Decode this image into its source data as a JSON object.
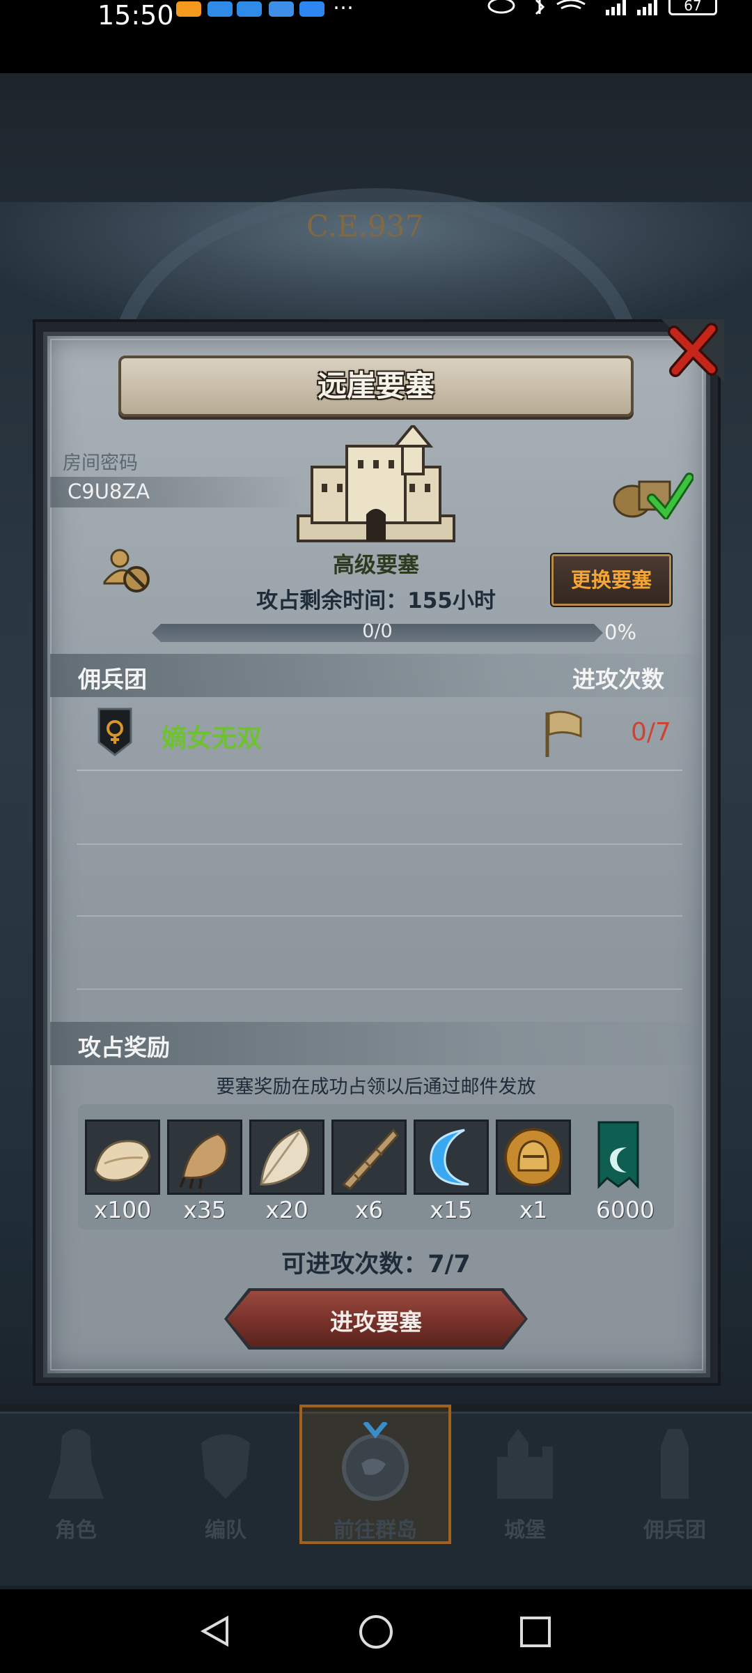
{
  "status_bar": {
    "time": "15:50",
    "dots": "…",
    "battery": "67"
  },
  "scene": {
    "era_label": "C.E.937"
  },
  "modal": {
    "title": "远崖要塞",
    "room_code_label": "房间密码",
    "room_code": "C9U8ZA",
    "fortress_level": "高级要塞",
    "change_fortress_label": "更换要塞",
    "occupy_time": "攻占剩余时间：155小时",
    "progress": {
      "count": "0/0",
      "percent": "0%",
      "fraction": 0
    },
    "guild_header": "佣兵团",
    "attacks_header": "进攻次数",
    "guild": {
      "name": "嫡女无双",
      "attacks": "0/7"
    },
    "reward_header": "攻占奖励",
    "reward_note": "要塞奖励在成功占领以后通过邮件发放",
    "rewards": [
      {
        "icon": "fur-icon",
        "qty": "x100"
      },
      {
        "icon": "claw-icon",
        "qty": "x35"
      },
      {
        "icon": "feather-icon",
        "qty": "x20"
      },
      {
        "icon": "horn-icon",
        "qty": "x6"
      },
      {
        "icon": "crescent-icon",
        "qty": "x15"
      },
      {
        "icon": "helmet-medal-icon",
        "qty": "x1"
      },
      {
        "icon": "guild-banner-icon",
        "qty": "6000"
      }
    ],
    "attack_count": "可进攻次数：7/7",
    "attack_button_label": "进攻要塞"
  },
  "game_nav": {
    "tabs": [
      {
        "label": "角色"
      },
      {
        "label": "编队"
      },
      {
        "label": "前往群岛"
      },
      {
        "label": "城堡"
      },
      {
        "label": "佣兵团"
      }
    ]
  },
  "colors": {
    "guild_name": "#6ec130",
    "attacks_used": "#cc4533",
    "button_accent": "#f4a535",
    "active_tab_border": "#a0621d"
  }
}
